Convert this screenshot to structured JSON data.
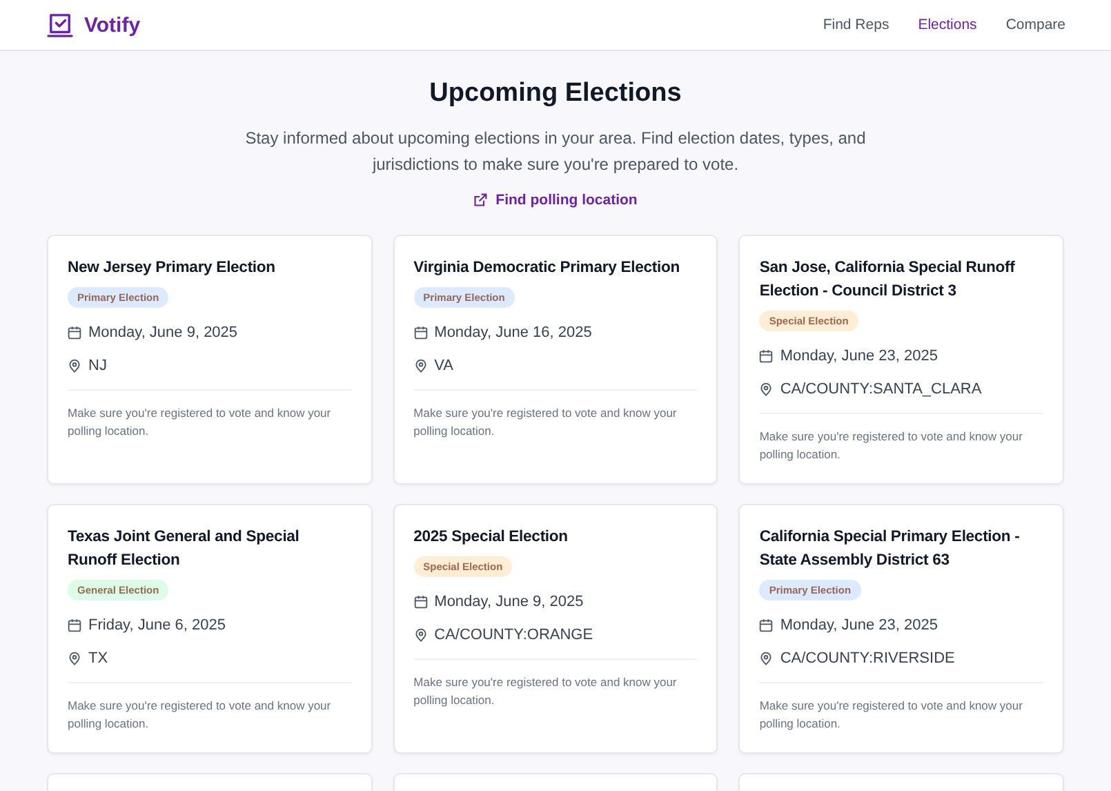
{
  "header": {
    "brand": "Votify",
    "nav": [
      {
        "label": "Find Reps",
        "selected": false
      },
      {
        "label": "Elections",
        "selected": true
      },
      {
        "label": "Compare",
        "selected": false
      }
    ]
  },
  "hero": {
    "title": "Upcoming Elections",
    "description": "Stay informed about upcoming elections in your area. Find election dates, types, and jurisdictions to make sure you're prepared to vote.",
    "link": "Find polling location"
  },
  "elections": [
    {
      "kind": "card",
      "title": "New Jersey Primary Election",
      "badge": {
        "label": "Primary Election",
        "color": "#dbeafe"
      },
      "date": "Monday, June 9, 2025",
      "location": "NJ",
      "note": "Make sure you're registered to vote and know your polling location."
    },
    {
      "kind": "card",
      "title": "Virginia Democratic Primary Election",
      "badge": {
        "label": "Primary Election",
        "color": "#dbeafe"
      },
      "date": "Monday, June 16, 2025",
      "location": "VA",
      "note": "Make sure you're registered to vote and know your polling location."
    },
    {
      "kind": "card",
      "title": "San Jose, California Special Runoff Election - Council District 3",
      "badge": {
        "label": "Special Election",
        "color": "#ffedd5"
      },
      "date": "Monday, June 23, 2025",
      "location": "CA/COUNTY:SANTA_CLARA",
      "note": "Make sure you're registered to vote and know your polling location."
    },
    {
      "kind": "card",
      "title": "Texas Joint General and Special Runoff Election",
      "badge": {
        "label": "General Election",
        "color": "#dcfce7"
      },
      "date": "Friday, June 6, 2025",
      "location": "TX",
      "note": "Make sure you're registered to vote and know your polling location."
    },
    {
      "kind": "card",
      "title": "2025 Special Election",
      "badge": {
        "label": "Special Election",
        "color": "#ffedd5"
      },
      "date": "Monday, June 9, 2025",
      "location": "CA/COUNTY:ORANGE",
      "note": "Make sure you're registered to vote and know your polling location."
    },
    {
      "kind": "card",
      "title": "California Special Primary Election - State Assembly District 63",
      "badge": {
        "label": "Primary Election",
        "color": "#dbeafe"
      },
      "date": "Monday, June 23, 2025",
      "location": "CA/COUNTY:RIVERSIDE",
      "note": "Make sure you're registered to vote and know your polling location."
    },
    {
      "kind": "cut_off"
    },
    {
      "kind": "cut_off"
    },
    {
      "kind": "cut_off"
    }
  ]
}
